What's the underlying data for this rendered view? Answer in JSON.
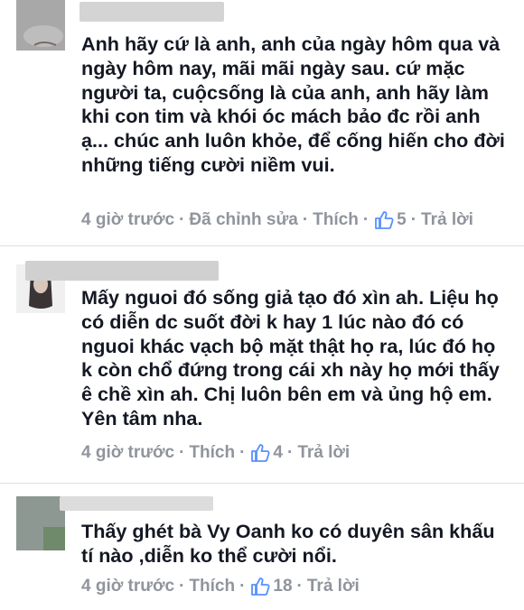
{
  "comments": [
    {
      "text": "Anh hãy cứ là anh, anh của ngày hôm qua và ngày hôm nay, mãi mãi ngày sau. cứ mặc người ta, cuộcsống là của anh, anh hãy làm khi con tim và khói óc mách bảo đc rồi anh ạ... chúc anh luôn khỏe, để cống hiến cho đời những tiếng cười niềm vui.",
      "time": "4 giờ trước",
      "edited": "Đã chỉnh sửa",
      "like_label": "Thích",
      "like_count": "5",
      "reply_label": "Trả lời"
    },
    {
      "text": "Mấy nguoi đó sống giả tạo đó xìn ah. Liệu họ có diễn dc suốt đời k hay 1 lúc nào đó có nguoi khác vạch bộ mặt thật họ ra, lúc đó họ k còn chổ đứng trong cái xh này họ mới thấy ê chề xìn ah. Chị luôn bên em và ủng hộ em. Yên tâm nha.",
      "time": "4 giờ trước",
      "like_label": "Thích",
      "like_count": "4",
      "reply_label": "Trả lời"
    },
    {
      "text": "Thấy ghét bà Vy Oanh ko có duyên sân khấu tí nào ,diễn ko thể cười nổi.",
      "time": "4 giờ trước",
      "like_label": "Thích",
      "like_count": "18",
      "reply_label": "Trả lời"
    }
  ],
  "colors": {
    "text": "#141823",
    "meta": "#90949c",
    "like_icon": "#5890ff",
    "divider": "#e0e0e0"
  },
  "icons": {
    "like": "thumbs-up-icon"
  }
}
